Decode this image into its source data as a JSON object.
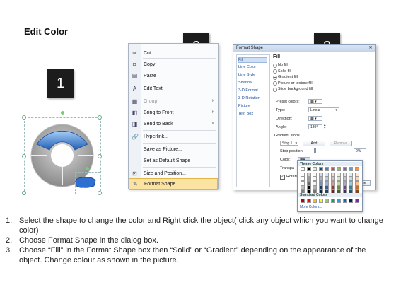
{
  "title": "Edit Color",
  "steps": {
    "s1": "1",
    "s2": "2",
    "s3": "3"
  },
  "context_menu": {
    "items": [
      {
        "label": "Cut",
        "icon": "scissors-icon",
        "glyph": "✂"
      },
      {
        "label": "Copy",
        "icon": "copy-icon",
        "glyph": "⧉"
      },
      {
        "label": "Paste",
        "icon": "paste-icon",
        "glyph": "▤"
      },
      {
        "label": "Edit Text",
        "icon": "edit-text-icon",
        "glyph": "A"
      },
      {
        "label": "Group",
        "icon": "group-icon",
        "glyph": "▦",
        "disabled": true,
        "arrow": true
      },
      {
        "label": "Bring to Front",
        "icon": "bring-front-icon",
        "glyph": "◧",
        "arrow": true
      },
      {
        "label": "Send to Back",
        "icon": "send-back-icon",
        "glyph": "◨",
        "arrow": true
      },
      {
        "label": "Hyperlink...",
        "icon": "hyperlink-icon",
        "glyph": "🔗"
      },
      {
        "label": "Save as Picture...",
        "icon": "",
        "glyph": ""
      },
      {
        "label": "Set as Default Shape",
        "icon": "",
        "glyph": ""
      },
      {
        "label": "Size and Position...",
        "icon": "size-position-icon",
        "glyph": "⊡"
      },
      {
        "label": "Format Shape...",
        "icon": "format-shape-icon",
        "glyph": "✎",
        "highlight": true
      }
    ]
  },
  "dialog": {
    "title": "Format Shape",
    "categories": [
      "Fill",
      "Line Color",
      "Line Style",
      "Shadow",
      "3-D Format",
      "3-D Rotation",
      "Picture",
      "Text Box"
    ],
    "heading": "Fill",
    "fill_options": [
      "No fill",
      "Solid fill",
      "Gradient fill",
      "Picture or texture fill",
      "Slide background fill"
    ],
    "preset_label": "Preset colors:",
    "type_label": "Type:",
    "type_value": "Linear",
    "direction_label": "Direction:",
    "angle_label": "Angle:",
    "angle_value": "180°",
    "gradient_stops_label": "Gradient stops",
    "stop_value": "Stop 1",
    "add_label": "Add",
    "remove_label": "Remove",
    "stop_position_label": "Stop position:",
    "stop_position_value": "0%",
    "color_label": "Color:",
    "transparency_label": "Transpa",
    "rotate_label": "Rotate",
    "close_label": "Close"
  },
  "palette": {
    "theme_label": "Theme Colors",
    "standard_label": "Standard Colors",
    "more_label": "More Colors...",
    "theme_top": [
      "#ffffff",
      "#000000",
      "#eeece1",
      "#1f497d",
      "#4f81bd",
      "#c0504d",
      "#9bbb59",
      "#8064a2",
      "#4bacc6",
      "#f79646"
    ],
    "standard": [
      "#c00000",
      "#ff0000",
      "#ffc000",
      "#ffff00",
      "#92d050",
      "#00b050",
      "#00b0f0",
      "#0070c0",
      "#002060",
      "#7030a0"
    ]
  },
  "instructions": [
    {
      "num": "1.",
      "text": "Select the shape to change the color and Right click the object( click any object which you want to change color)"
    },
    {
      "num": "2.",
      "text": "Choose Format Shape in the dialog box."
    },
    {
      "num": "3.",
      "text": "Choose “Fill” in the Format Shape box then “Solid” or “Gradient” depending on the appearance of the object. Change colour as shown in the picture."
    }
  ],
  "colors": {
    "accent_blue": "#3b7fd6",
    "menu_highlight": "#fbe3a2",
    "step_box": "#1c1c1c"
  }
}
